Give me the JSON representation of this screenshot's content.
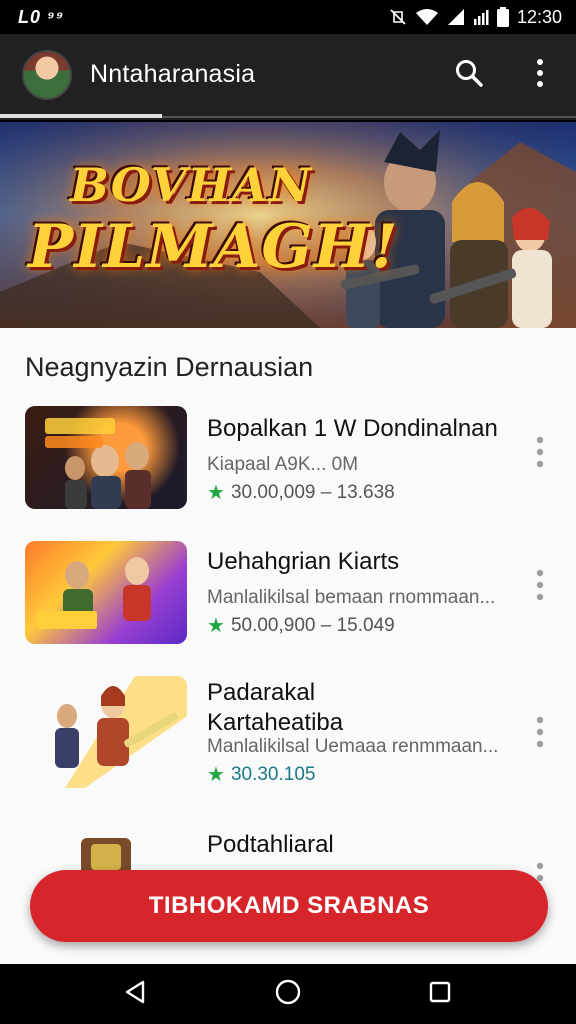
{
  "status_bar": {
    "left_text": "L0 ⁹⁹",
    "time": "12:30"
  },
  "app_bar": {
    "title": "Nntaharanasia"
  },
  "hero": {
    "line1": "BOVHAN",
    "line2": "PILMAGH!"
  },
  "section": {
    "title": "Neagnyazin Dernausian"
  },
  "items": [
    {
      "title": "Bopalkan 1 W Dondinalnan",
      "subtitle": "Kiapaal A9K...    0M",
      "rating": "30.00,009 – 13.638"
    },
    {
      "title": "Uehahgrian Kiarts",
      "subtitle": "Manlalikilsal bemaan rnommaan...",
      "rating": "50.00,900 – 15.049"
    },
    {
      "title_line1": "Padarakal",
      "title_line2": "Kartaheatiba",
      "subtitle": "Manlalikilsal Uemaaa renmmaan...",
      "rating": "30.30.105"
    },
    {
      "title": "Podtahliaral"
    }
  ],
  "cta": {
    "label": "TIBHOKAMD SRABNAS"
  },
  "colors": {
    "accent": "#d7262b",
    "star": "#1fa542",
    "app_bar": "#212121"
  },
  "icons": [
    "search-icon",
    "more-vert-icon",
    "star-icon",
    "back-icon",
    "home-icon",
    "recents-icon",
    "wifi-icon",
    "signal-icon",
    "battery-icon"
  ]
}
